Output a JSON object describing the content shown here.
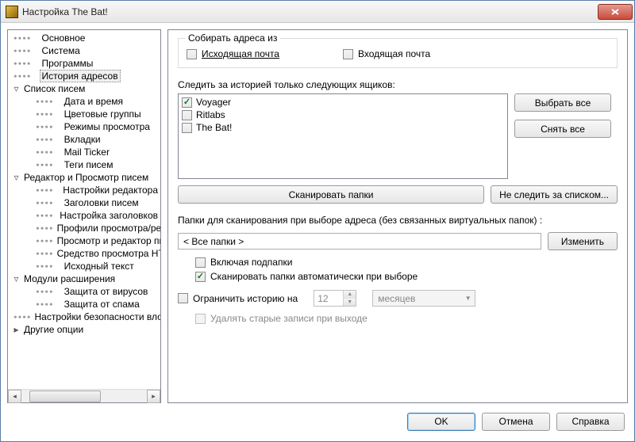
{
  "window": {
    "title": "Настройка The Bat!"
  },
  "tree": [
    {
      "label": "Основное",
      "d": 1,
      "exp": ""
    },
    {
      "label": "Система",
      "d": 1,
      "exp": ""
    },
    {
      "label": "Программы",
      "d": 1,
      "exp": ""
    },
    {
      "label": "История адресов",
      "d": 1,
      "exp": "",
      "sel": true
    },
    {
      "label": "Список писем",
      "d": 0,
      "exp": "▿"
    },
    {
      "label": "Дата и время",
      "d": 2,
      "exp": ""
    },
    {
      "label": "Цветовые группы",
      "d": 2,
      "exp": ""
    },
    {
      "label": "Режимы просмотра",
      "d": 2,
      "exp": ""
    },
    {
      "label": "Вкладки",
      "d": 2,
      "exp": ""
    },
    {
      "label": "Mail Ticker",
      "d": 2,
      "exp": ""
    },
    {
      "label": "Теги писем",
      "d": 2,
      "exp": ""
    },
    {
      "label": "Редактор и Просмотр писем",
      "d": 0,
      "exp": "▿"
    },
    {
      "label": "Настройки редактора",
      "d": 2,
      "exp": ""
    },
    {
      "label": "Заголовки писем",
      "d": 2,
      "exp": ""
    },
    {
      "label": "Настройка заголовков",
      "d": 2,
      "exp": ""
    },
    {
      "label": "Профили просмотра/редак",
      "d": 2,
      "exp": ""
    },
    {
      "label": "Просмотр и редактор писем",
      "d": 2,
      "exp": ""
    },
    {
      "label": "Средство просмотра HTML",
      "d": 2,
      "exp": ""
    },
    {
      "label": "Исходный текст",
      "d": 2,
      "exp": ""
    },
    {
      "label": "Модули расширения",
      "d": 0,
      "exp": "▿"
    },
    {
      "label": "Защита от вирусов",
      "d": 2,
      "exp": ""
    },
    {
      "label": "Защита от спама",
      "d": 2,
      "exp": ""
    },
    {
      "label": "Настройки безопасности влож",
      "d": 1,
      "exp": ""
    },
    {
      "label": "Другие опции",
      "d": 0,
      "exp": "▸"
    }
  ],
  "collect": {
    "legend": "Собирать адреса из",
    "outgoing": "Исходящая почта",
    "incoming": "Входящая почта"
  },
  "track": {
    "label": "Следить за историей только следующих ящиков:",
    "items": [
      {
        "label": "Voyager",
        "checked": true
      },
      {
        "label": "Ritlabs",
        "checked": false
      },
      {
        "label": "The Bat!",
        "checked": false
      }
    ],
    "select_all": "Выбрать все",
    "deselect_all": "Снять все",
    "scan": "Сканировать папки",
    "ignore": "Не следить за списком..."
  },
  "folders": {
    "label": "Папки для сканирования при выборе адреса (без связанных виртуальных папок) :",
    "value": "< Все папки >",
    "change": "Изменить",
    "subfolders": "Включая подпапки",
    "auto": "Сканировать папки автоматически при выборе"
  },
  "limit": {
    "label": "Ограничить историю на",
    "value": "12",
    "unit": "месяцев",
    "purge": "Удалять старые записи при выходе"
  },
  "buttons": {
    "ok": "OK",
    "cancel": "Отмена",
    "help": "Справка"
  }
}
